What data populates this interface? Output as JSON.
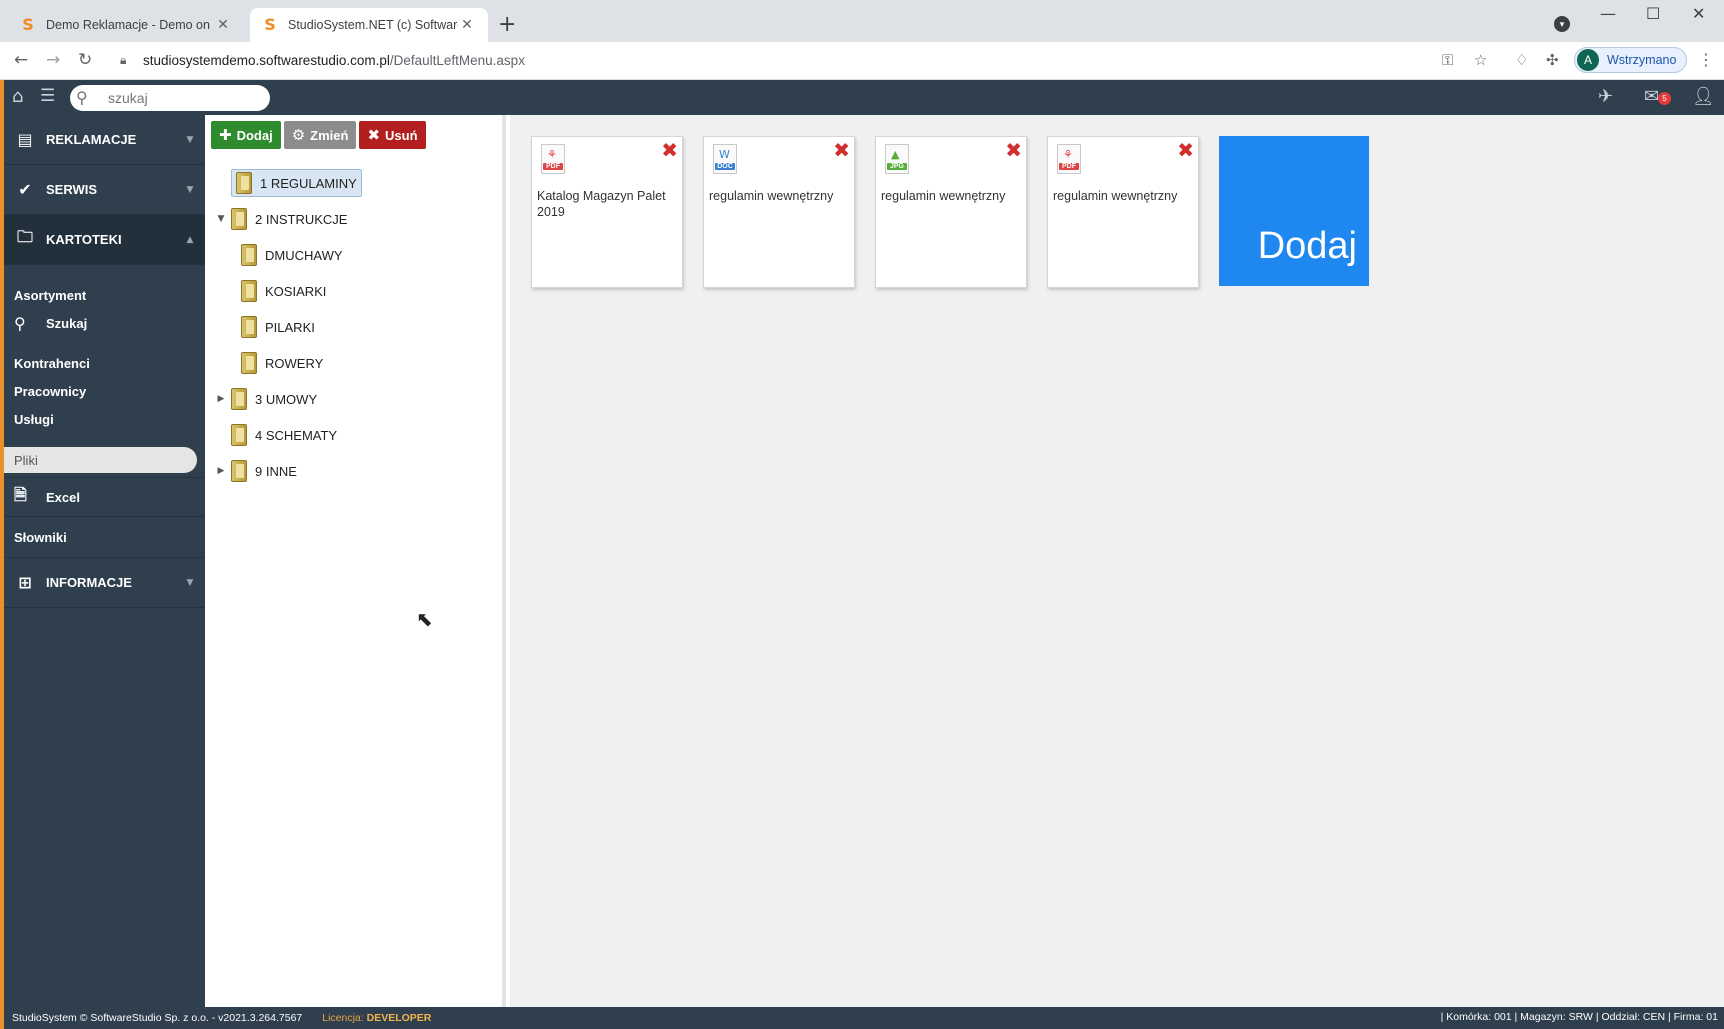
{
  "browser": {
    "tabs": [
      {
        "title": "Demo Reklamacje - Demo on line",
        "favicon": "S",
        "close": "✕"
      },
      {
        "title": "StudioSystem.NET (c) SoftwareStudio",
        "favicon": "S",
        "close": "✕"
      }
    ],
    "new_tab": "+",
    "url_host": "studiosystemdemo.softwarestudio.com.pl",
    "url_path": "/DefaultLeftMenu.aspx",
    "profile_initial": "A",
    "profile_label": "Wstrzymano"
  },
  "app": {
    "search_placeholder": "szukaj",
    "mail_badge": "5"
  },
  "sidebar": {
    "main_items": [
      {
        "label": "REKLAMACJE",
        "icon": "document-icon"
      },
      {
        "label": "SERWIS",
        "icon": "check-icon"
      },
      {
        "label": "KARTOTEKI",
        "icon": "folder-icon"
      }
    ],
    "sub_items": {
      "asortyment": "Asortyment",
      "szukaj": "Szukaj",
      "kontrahenci": "Kontrahenci",
      "pracownicy": "Pracownicy",
      "uslugi": "Usługi",
      "pliki": "Pliki",
      "excel": "Excel",
      "slowniki": "Słowniki"
    },
    "informacje": "INFORMACJE"
  },
  "toolbar": {
    "add_label": "Dodaj",
    "edit_label": "Zmień",
    "delete_label": "Usuń"
  },
  "tree": {
    "regulaminy": "1 REGULAMINY",
    "instrukcje": "2 INSTRUKCJE",
    "dmuchawy": "DMUCHAWY",
    "kosiarki": "KOSIARKI",
    "pilarki": "PILARKI",
    "rowery": "ROWERY",
    "umowy": "3 UMOWY",
    "schematy": "4 SCHEMATY",
    "inne": "9 INNE"
  },
  "files": [
    {
      "name": "Katalog Magazyn Palet 2019",
      "ext": "PDF",
      "color": "#e04545"
    },
    {
      "name": "regulamin wewnętrzny",
      "ext": "DOC",
      "color": "#3a7fd0"
    },
    {
      "name": "regulamin wewnętrzny",
      "ext": "JPG",
      "color": "#5aaf3c"
    },
    {
      "name": "regulamin wewnętrzny",
      "ext": "PDF",
      "color": "#e04545"
    }
  ],
  "add_tile_label": "Dodaj",
  "status": {
    "copyright": "StudioSystem © SoftwareStudio Sp. z o.o. - v2021.3.264.7567",
    "license_label": "Licencja:",
    "license_value": "DEVELOPER",
    "right": "| Komórka: 001 | Magazyn: SRW | Oddział: CEN | Firma: 01"
  },
  "colors": {
    "sidebar_bg": "#2f3f4e",
    "accent_orange": "#e8912d",
    "add_green": "#2e8b2e",
    "delete_red": "#b31f1f",
    "tile_blue": "#1e88f0"
  }
}
